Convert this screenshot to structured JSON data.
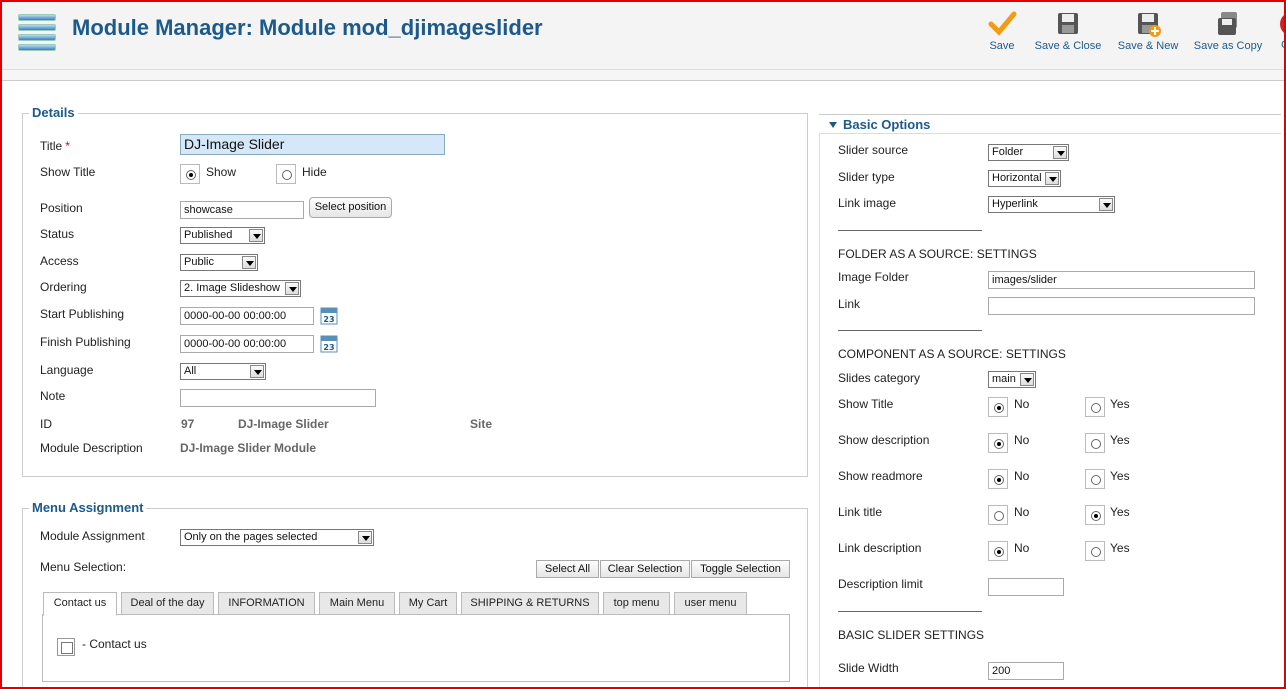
{
  "header": {
    "title": "Module Manager: Module mod_djimageslider",
    "toolbar": [
      {
        "label": "Save",
        "icon": "checkmark-icon"
      },
      {
        "label": "Save & Close",
        "icon": "floppy-icon"
      },
      {
        "label": "Save & New",
        "icon": "floppy-new-icon"
      },
      {
        "label": "Save as Copy",
        "icon": "copy-icon"
      },
      {
        "label": "C",
        "icon": "close-icon"
      }
    ]
  },
  "details": {
    "legend": "Details",
    "title_label": "Title",
    "title_required": "*",
    "title_value": "DJ-Image Slider",
    "show_title_label": "Show Title",
    "show_label": "Show",
    "hide_label": "Hide",
    "position_label": "Position",
    "position_value": "showcase",
    "select_position": "Select position",
    "status_label": "Status",
    "status_value": "Published",
    "access_label": "Access",
    "access_value": "Public",
    "ordering_label": "Ordering",
    "ordering_value": "2. Image Slideshow",
    "start_label": "Start Publishing",
    "start_value": "0000-00-00 00:00:00",
    "finish_label": "Finish Publishing",
    "finish_value": "0000-00-00 00:00:00",
    "calendar_text": "23",
    "language_label": "Language",
    "language_value": "All",
    "note_label": "Note",
    "note_value": "",
    "id_label": "ID",
    "id_value": "97",
    "id_name": "DJ-Image Slider",
    "id_client": "Site",
    "desc_label": "Module Description",
    "desc_value": "DJ-Image Slider Module"
  },
  "menu": {
    "legend": "Menu Assignment",
    "assignment_label": "Module Assignment",
    "assignment_value": "Only on the pages selected",
    "selection_label": "Menu Selection:",
    "select_all": "Select All",
    "clear_selection": "Clear Selection",
    "toggle_selection": "Toggle Selection",
    "tabs": [
      "Contact us",
      "Deal of the day",
      "INFORMATION",
      "Main Menu",
      "My Cart",
      "SHIPPING & RETURNS",
      "top menu",
      "user menu"
    ],
    "item_label": "- Contact us"
  },
  "basic": {
    "title": "Basic Options",
    "slider_source_label": "Slider source",
    "slider_source_value": "Folder",
    "slider_type_label": "Slider type",
    "slider_type_value": "Horizontal",
    "link_image_label": "Link image",
    "link_image_value": "Hyperlink",
    "folder_section": "FOLDER AS A SOURCE: SETTINGS",
    "image_folder_label": "Image Folder",
    "image_folder_value": "images/slider",
    "link_label": "Link",
    "link_value": "",
    "component_section": "COMPONENT AS A SOURCE: SETTINGS",
    "slides_category_label": "Slides category",
    "slides_category_value": "main",
    "no_label": "No",
    "yes_label": "Yes",
    "toggles": [
      {
        "label": "Show Title",
        "value": "No"
      },
      {
        "label": "Show description",
        "value": "No"
      },
      {
        "label": "Show readmore",
        "value": "No"
      },
      {
        "label": "Link title",
        "value": "Yes"
      },
      {
        "label": "Link description",
        "value": "No"
      }
    ],
    "description_limit_label": "Description limit",
    "description_limit_value": "",
    "basic_section": "BASIC SLIDER SETTINGS",
    "slide_width_label": "Slide Width",
    "slide_width_value": "200"
  }
}
